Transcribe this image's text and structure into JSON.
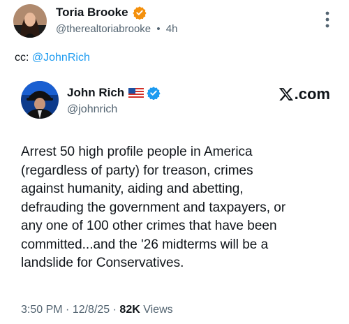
{
  "outer_post": {
    "display_name": "Toria Brooke",
    "handle": "@therealtoriabrooke",
    "separator": "•",
    "time": "4h",
    "verified_badge": "verified-badge-orange",
    "badge_color": "#f4900c",
    "more_icon": "more-vertical-icon",
    "text_prefix": "cc: ",
    "mention": "@JohnRich"
  },
  "quoted_post": {
    "display_name": "John Rich",
    "flag_icon": "us-flag-icon",
    "verified_badge": "verified-badge-blue",
    "badge_color": "#1d9bf0",
    "handle": "@johnrich",
    "site_label": ".com",
    "site_logo": "x-logo-icon",
    "body": "Arrest 50 high profile people in America\n(regardless of party) for treason, crimes\nagainst humanity, aiding and abetting,\ndefrauding the government and taxpayers, or\nany one of 100 other crimes that have been\ncommitted...and the '26 midterms will be a\nlandslide for Conservatives.",
    "time": "3:50 PM",
    "sep1": " · ",
    "date": "12/8/25",
    "sep2": " · ",
    "views_count": "82K",
    "views_label": " Views"
  },
  "colors": {
    "link": "#1d9bf0",
    "secondary_text": "#536471",
    "primary_text": "#0f1419"
  }
}
